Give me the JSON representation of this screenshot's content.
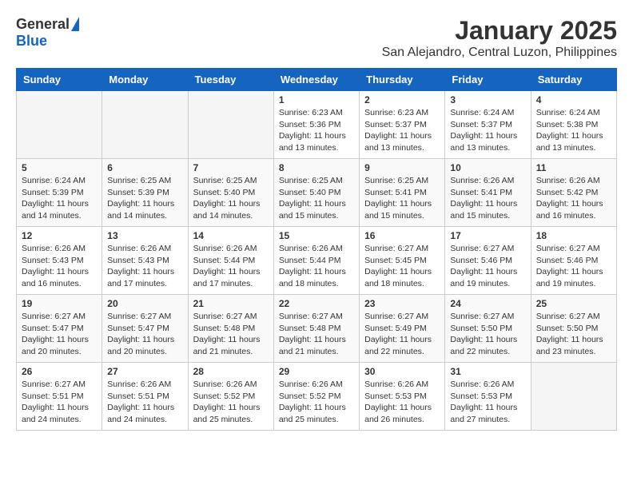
{
  "logo": {
    "general": "General",
    "blue": "Blue"
  },
  "title": "January 2025",
  "subtitle": "San Alejandro, Central Luzon, Philippines",
  "days": [
    "Sunday",
    "Monday",
    "Tuesday",
    "Wednesday",
    "Thursday",
    "Friday",
    "Saturday"
  ],
  "weeks": [
    [
      {
        "day": "",
        "info": ""
      },
      {
        "day": "",
        "info": ""
      },
      {
        "day": "",
        "info": ""
      },
      {
        "day": "1",
        "info": "Sunrise: 6:23 AM\nSunset: 5:36 PM\nDaylight: 11 hours and 13 minutes."
      },
      {
        "day": "2",
        "info": "Sunrise: 6:23 AM\nSunset: 5:37 PM\nDaylight: 11 hours and 13 minutes."
      },
      {
        "day": "3",
        "info": "Sunrise: 6:24 AM\nSunset: 5:37 PM\nDaylight: 11 hours and 13 minutes."
      },
      {
        "day": "4",
        "info": "Sunrise: 6:24 AM\nSunset: 5:38 PM\nDaylight: 11 hours and 13 minutes."
      }
    ],
    [
      {
        "day": "5",
        "info": "Sunrise: 6:24 AM\nSunset: 5:39 PM\nDaylight: 11 hours and 14 minutes."
      },
      {
        "day": "6",
        "info": "Sunrise: 6:25 AM\nSunset: 5:39 PM\nDaylight: 11 hours and 14 minutes."
      },
      {
        "day": "7",
        "info": "Sunrise: 6:25 AM\nSunset: 5:40 PM\nDaylight: 11 hours and 14 minutes."
      },
      {
        "day": "8",
        "info": "Sunrise: 6:25 AM\nSunset: 5:40 PM\nDaylight: 11 hours and 15 minutes."
      },
      {
        "day": "9",
        "info": "Sunrise: 6:25 AM\nSunset: 5:41 PM\nDaylight: 11 hours and 15 minutes."
      },
      {
        "day": "10",
        "info": "Sunrise: 6:26 AM\nSunset: 5:41 PM\nDaylight: 11 hours and 15 minutes."
      },
      {
        "day": "11",
        "info": "Sunrise: 6:26 AM\nSunset: 5:42 PM\nDaylight: 11 hours and 16 minutes."
      }
    ],
    [
      {
        "day": "12",
        "info": "Sunrise: 6:26 AM\nSunset: 5:43 PM\nDaylight: 11 hours and 16 minutes."
      },
      {
        "day": "13",
        "info": "Sunrise: 6:26 AM\nSunset: 5:43 PM\nDaylight: 11 hours and 17 minutes."
      },
      {
        "day": "14",
        "info": "Sunrise: 6:26 AM\nSunset: 5:44 PM\nDaylight: 11 hours and 17 minutes."
      },
      {
        "day": "15",
        "info": "Sunrise: 6:26 AM\nSunset: 5:44 PM\nDaylight: 11 hours and 18 minutes."
      },
      {
        "day": "16",
        "info": "Sunrise: 6:27 AM\nSunset: 5:45 PM\nDaylight: 11 hours and 18 minutes."
      },
      {
        "day": "17",
        "info": "Sunrise: 6:27 AM\nSunset: 5:46 PM\nDaylight: 11 hours and 19 minutes."
      },
      {
        "day": "18",
        "info": "Sunrise: 6:27 AM\nSunset: 5:46 PM\nDaylight: 11 hours and 19 minutes."
      }
    ],
    [
      {
        "day": "19",
        "info": "Sunrise: 6:27 AM\nSunset: 5:47 PM\nDaylight: 11 hours and 20 minutes."
      },
      {
        "day": "20",
        "info": "Sunrise: 6:27 AM\nSunset: 5:47 PM\nDaylight: 11 hours and 20 minutes."
      },
      {
        "day": "21",
        "info": "Sunrise: 6:27 AM\nSunset: 5:48 PM\nDaylight: 11 hours and 21 minutes."
      },
      {
        "day": "22",
        "info": "Sunrise: 6:27 AM\nSunset: 5:48 PM\nDaylight: 11 hours and 21 minutes."
      },
      {
        "day": "23",
        "info": "Sunrise: 6:27 AM\nSunset: 5:49 PM\nDaylight: 11 hours and 22 minutes."
      },
      {
        "day": "24",
        "info": "Sunrise: 6:27 AM\nSunset: 5:50 PM\nDaylight: 11 hours and 22 minutes."
      },
      {
        "day": "25",
        "info": "Sunrise: 6:27 AM\nSunset: 5:50 PM\nDaylight: 11 hours and 23 minutes."
      }
    ],
    [
      {
        "day": "26",
        "info": "Sunrise: 6:27 AM\nSunset: 5:51 PM\nDaylight: 11 hours and 24 minutes."
      },
      {
        "day": "27",
        "info": "Sunrise: 6:26 AM\nSunset: 5:51 PM\nDaylight: 11 hours and 24 minutes."
      },
      {
        "day": "28",
        "info": "Sunrise: 6:26 AM\nSunset: 5:52 PM\nDaylight: 11 hours and 25 minutes."
      },
      {
        "day": "29",
        "info": "Sunrise: 6:26 AM\nSunset: 5:52 PM\nDaylight: 11 hours and 25 minutes."
      },
      {
        "day": "30",
        "info": "Sunrise: 6:26 AM\nSunset: 5:53 PM\nDaylight: 11 hours and 26 minutes."
      },
      {
        "day": "31",
        "info": "Sunrise: 6:26 AM\nSunset: 5:53 PM\nDaylight: 11 hours and 27 minutes."
      },
      {
        "day": "",
        "info": ""
      }
    ]
  ]
}
